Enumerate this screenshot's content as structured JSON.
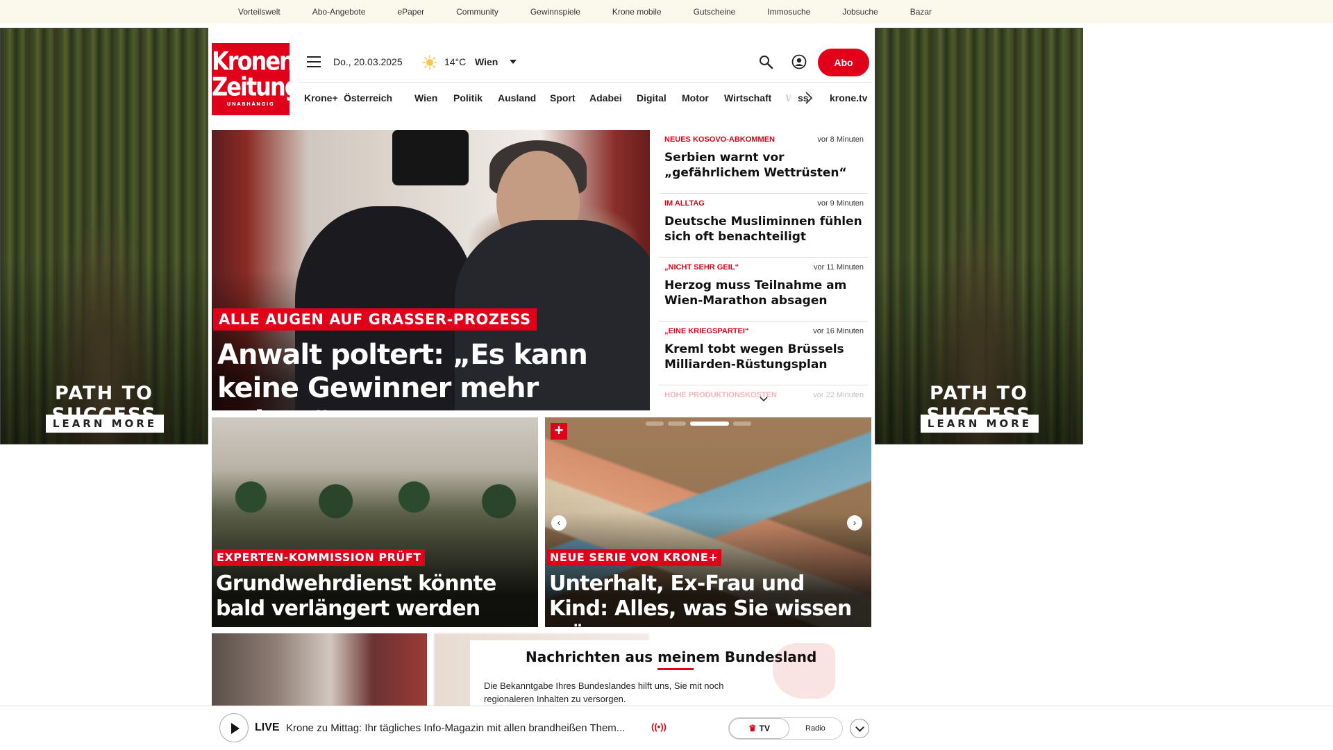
{
  "topbar": {
    "links": [
      "Vorteilswelt",
      "Abo-Angebote",
      "ePaper",
      "Community",
      "Gewinnspiele",
      "Krone mobile",
      "Gutscheine",
      "Immosuche",
      "Jobsuche",
      "Bazar"
    ]
  },
  "ads": {
    "left": {
      "title": "PATH TO SUCCESS",
      "button": "LEARN MORE"
    },
    "right": {
      "title": "PATH TO SUCCESS",
      "button": "LEARN MORE"
    }
  },
  "logo": {
    "line1": "Kronen",
    "line2": "Zeitung",
    "tagline": "UNABHÄNGIG"
  },
  "header": {
    "date": "Do., 20.03.2025",
    "temperature": "14°C",
    "city": "Wien",
    "abo_label": "Abo",
    "icons": {
      "menu": "menu-icon",
      "weather": "sun-icon",
      "search": "search-icon",
      "account": "user-icon"
    }
  },
  "nav": {
    "items": [
      "Krone+",
      "Österreich",
      "Wien",
      "Politik",
      "Ausland",
      "Sport",
      "Adabei",
      "Digital",
      "Motor",
      "Wirtschaft",
      "Wiss"
    ],
    "tv": "krone.tv"
  },
  "hero": {
    "kicker": "ALLE AUGEN AUF GRASSER-PROZESS",
    "headline": "Anwalt poltert: „Es kann keine Gewinner mehr geben“"
  },
  "news": [
    {
      "category": "NEUES KOSOVO-ABKOMMEN",
      "time": "vor 8 Minuten",
      "title": "Serbien warnt vor „gefährlichem Wettrüsten“"
    },
    {
      "category": "IM ALLTAG",
      "time": "vor 9 Minuten",
      "title": "Deutsche Musliminnen fühlen sich oft benachteiligt"
    },
    {
      "category": "„NICHT SEHR GEIL“",
      "time": "vor 11 Minuten",
      "title": "Herzog muss Teilnahme am Wien-Marathon absagen"
    },
    {
      "category": "„EINE KRIEGSPARTEI“",
      "time": "vor 16 Minuten",
      "title": "Kreml tobt wegen Brüssels Milliarden-Rüstungsplan"
    },
    {
      "category": "HOHE PRODUKTIONSKOSTEN",
      "time": "vor 22 Minuten",
      "title": ""
    }
  ],
  "cards": [
    {
      "kicker": "EXPERTEN-KOMMISSION PRÜFT",
      "headline": "Grundwehrdienst könnte bald verlängert werden"
    },
    {
      "kicker": "NEUE SERIE VON KRONE+",
      "headline": "Unterhalt, Ex-Frau und Kind: Alles, was Sie wissen müssen",
      "badge": "+"
    }
  ],
  "bundesland": {
    "title": "Nachrichten aus meinem Bundesland",
    "text": "Die Bekanntgabe Ihres Bundeslandes hilft uns, Sie mit noch regionaleren Inhalten zu versorgen."
  },
  "livebar": {
    "label": "LIVE",
    "text": "Krone zu Mittag: Ihr tägliches Info-Magazin mit allen brandheißen Them...",
    "tv_label": "TV",
    "radio_label": "Radio"
  },
  "colors": {
    "brand_red": "#e0001a",
    "topbar_bg": "#fbf8ec"
  }
}
